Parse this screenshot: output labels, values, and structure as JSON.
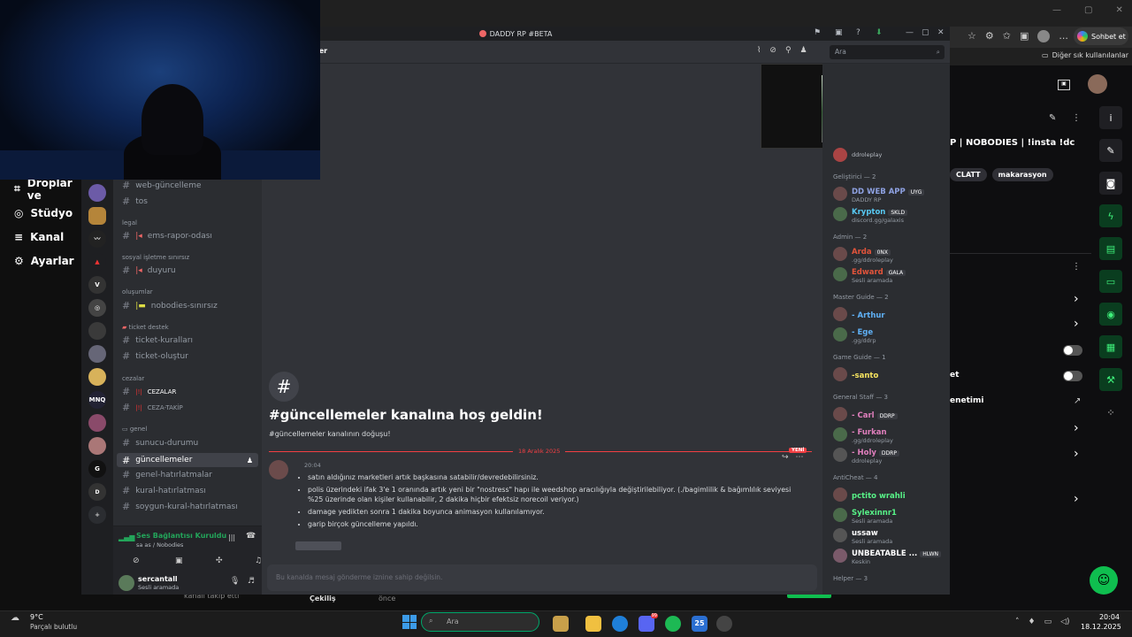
{
  "browser": {
    "more_label": "...",
    "copilot_label": "Sohbet et",
    "favorites_label": "Diğer sık kullanılanlar"
  },
  "twitch": {
    "nav": [
      "Droplar ve",
      "Stüdyo",
      "Kanal",
      "Ayarlar"
    ],
    "stream_title": "P | NOBODIES | !insta !dc",
    "tags": [
      "CLATT",
      "makarasyon"
    ],
    "right_text_1": "et",
    "right_text_2": "enetimi",
    "footer_text_1": "kanalı takip etti",
    "footer_text_2": "Çekiliş",
    "footer_text_3": "önce"
  },
  "discord": {
    "window_title": "DADDY RP #BETA",
    "header_channel": "ler",
    "search_placeholder": "Ara",
    "categories": {
      "legal": "legal",
      "sosyal": "sosyal işletme Sınırsız",
      "olusumlar": "oluşumlar",
      "ticket": "Ticket Destek",
      "cezalar": "CEZALAR",
      "genel": "Genel"
    },
    "channels": {
      "web": "web-güncelleme",
      "tos": "tos",
      "ems": "ems-rapor-odası",
      "duyuru": "duyuru",
      "nobodies": "nobodies-sınırsız",
      "ticket_rules": "ticket-kuralları",
      "ticket_create": "ticket-oluştur",
      "cezalar": "CEZALAR",
      "ceza_takip": "CEZA-TAKİP",
      "sunucu": "sunucu-durumu",
      "guncellemeler": "güncellemeler",
      "genel_hatirlatmalar": "genel-hatırlatmalar",
      "kural": "kural-hatırlatması",
      "soygun": "soygun-kural-hatırlatması"
    },
    "voice": {
      "status": "Ses Bağlantısı Kuruldu",
      "channel": "sa as / Nobodies"
    },
    "user": {
      "name": "sercantall",
      "status": "Sesli aramada"
    },
    "welcome": {
      "title": "#güncellemeler kanalına hoş geldin!",
      "subtitle": "#güncellemeler kanalının doğuşu!"
    },
    "divider_date": "18 Aralık 2025",
    "new_badge": "YENİ",
    "message": {
      "time": "20:04",
      "lines": [
        "satın aldığınız marketleri artık başkasına satabilir/devredebilirsiniz.",
        "polis üzerindeki ifak 3'e 1 oranında artık yeni bir \"nostress\" hapı ile weedshop aracılığıyla değiştirilebiliyor. (./bagimlilik & bağımlılık seviyesi %25 üzerinde olan kişiler kullanabilir, 2 dakika hiçbir efektsiz norecoil veriyor.)",
        "damage yedikten sonra 1 dakika boyunca animasyon kullanılamıyor.",
        "garip birçok güncelleme yapıldı."
      ]
    },
    "input_placeholder": "Bu kanalda mesaj gönderme iznine sahip değilsin.",
    "member_groups": [
      {
        "title": "Geliştirici — 2",
        "members": [
          {
            "name": "DD WEB APP",
            "tag": "UYG",
            "status": "DADDY RP",
            "color": "#8ea1e1"
          },
          {
            "name": "Krypton",
            "tag": "SKLD",
            "status": "discord.gg/galaxis",
            "color": "#57c8f2"
          }
        ]
      },
      {
        "title": "Admin — 2",
        "members": [
          {
            "name": "Arda",
            "tag": "0NX",
            "status": ".gg/ddroleplay",
            "color": "#e2543b"
          },
          {
            "name": "Edward",
            "tag": "GALA",
            "status": "Sesli aramada",
            "color": "#e2543b"
          }
        ]
      },
      {
        "title": "Master Guide — 2",
        "members": [
          {
            "name": "- Arthur",
            "tag": "",
            "status": "",
            "color": "#5fb0f5"
          },
          {
            "name": "- Ege",
            "tag": "",
            "status": ".gg/ddrp",
            "color": "#5fb0f5"
          }
        ]
      },
      {
        "title": "Game Guide — 1",
        "members": [
          {
            "name": "-santo",
            "tag": "",
            "status": "",
            "color": "#f5e35f"
          }
        ]
      },
      {
        "title": "General Staff — 3",
        "members": [
          {
            "name": "- Carl",
            "tag": "DDRP",
            "status": "",
            "color": "#e07fbd"
          },
          {
            "name": "- Furkan",
            "tag": "",
            "status": ".gg/ddroleplay",
            "color": "#e07fbd"
          },
          {
            "name": "- Holy",
            "tag": "DDRP",
            "status": "ddroleplay",
            "color": "#e07fbd"
          }
        ]
      },
      {
        "title": "AntiCheat — 4",
        "members": [
          {
            "name": "pctito wrahli",
            "tag": "",
            "status": "",
            "color": "#57f287"
          },
          {
            "name": "Sylexinnr1",
            "tag": "",
            "status": "Sesli aramada",
            "color": "#57f287"
          },
          {
            "name": "ussaw",
            "tag": "",
            "status": "Sesli aramada",
            "color": "#ffffff"
          },
          {
            "name": "UNBEATABLE ...",
            "tag": "HLWN",
            "status": "Keskin",
            "color": "#ffffff"
          }
        ]
      },
      {
        "title": "Helper — 3",
        "members": []
      }
    ],
    "top_member_status": "ddroleplay"
  },
  "taskbar": {
    "weather_temp": "9°C",
    "weather_desc": "Parçalı bulutlu",
    "search_placeholder": "Ara",
    "time": "20:04",
    "date": "18.12.2025",
    "discord_badge": "99",
    "app_badge": "25"
  }
}
